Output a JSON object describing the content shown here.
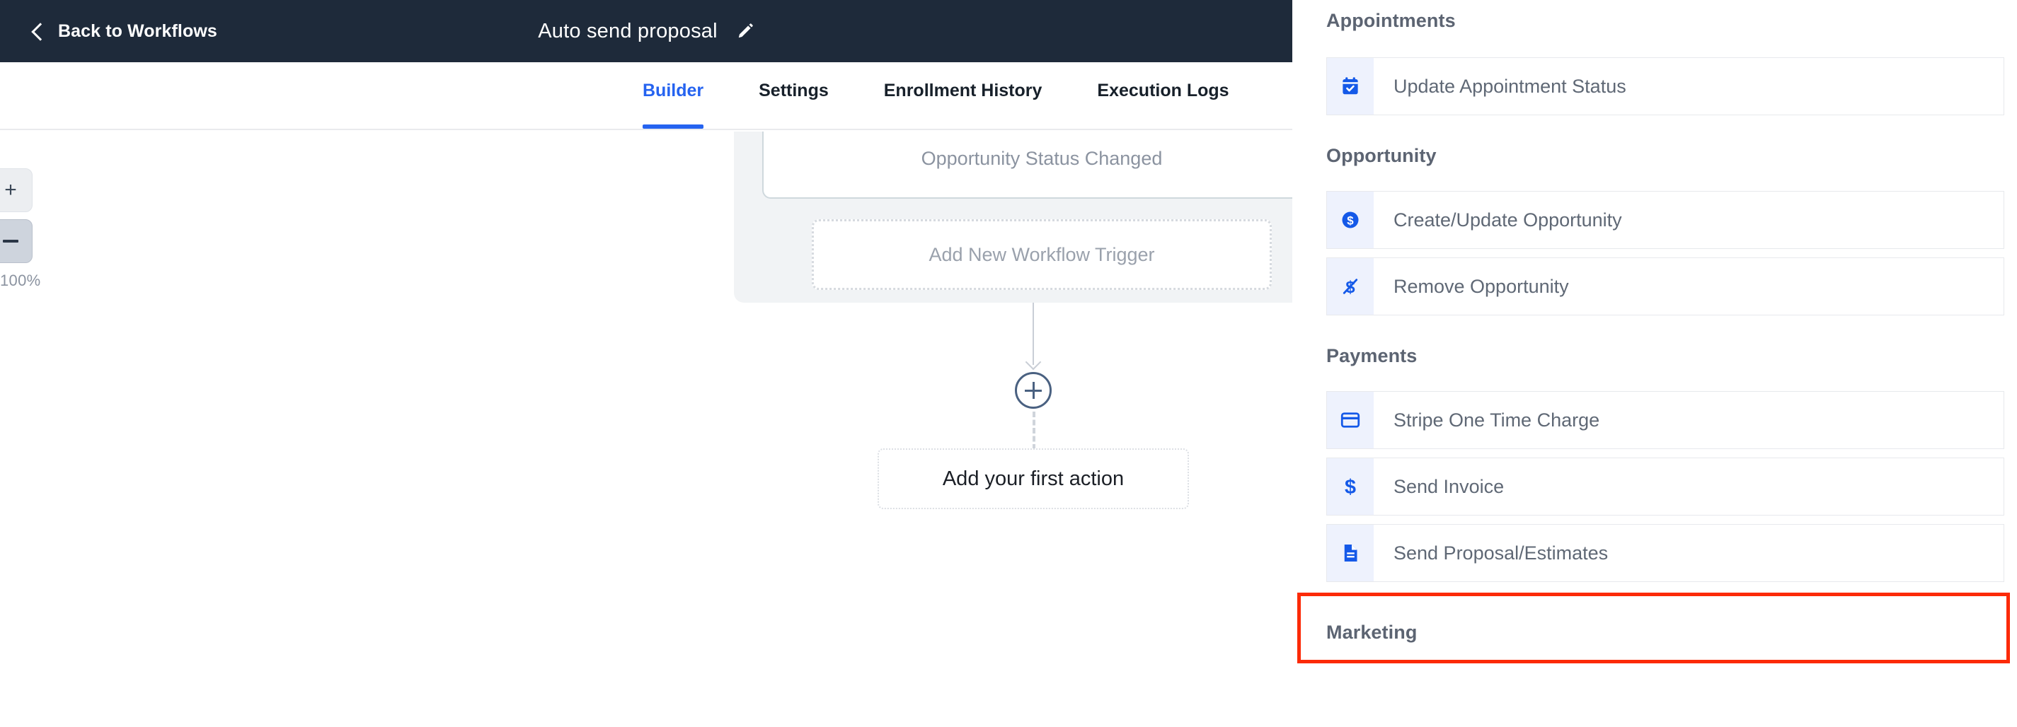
{
  "header": {
    "back_label": "Back to Workflows",
    "back_icon": "chevron-left-icon",
    "title": "Auto send proposal",
    "edit_icon": "pencil-edit-icon",
    "bg_color": "#1e2a3a"
  },
  "tabs": [
    {
      "label": "Builder",
      "active": true
    },
    {
      "label": "Settings",
      "active": false
    },
    {
      "label": "Enrollment History",
      "active": false
    },
    {
      "label": "Execution Logs",
      "active": false
    }
  ],
  "accent_color": "#2563f0",
  "canvas": {
    "zoom": {
      "in_label": "+",
      "out_label": "−",
      "level": "100%"
    },
    "trigger_card_label": "Opportunity Status Changed",
    "add_trigger_label": "Add New Workflow Trigger",
    "plus_node_icon": "plus-circle-icon",
    "first_action_label": "Add your first action"
  },
  "panel": {
    "sections": [
      {
        "title": "Appointments",
        "items": [
          {
            "label": "Update Appointment Status",
            "icon": "calendar-check-icon",
            "highlighted": false
          }
        ]
      },
      {
        "title": "Opportunity",
        "items": [
          {
            "label": "Create/Update Opportunity",
            "icon": "dollar-circle-icon",
            "highlighted": false
          },
          {
            "label": "Remove Opportunity",
            "icon": "dollar-slash-icon",
            "highlighted": false
          }
        ]
      },
      {
        "title": "Payments",
        "items": [
          {
            "label": "Stripe One Time Charge",
            "icon": "credit-card-icon",
            "highlighted": false
          },
          {
            "label": "Send Invoice",
            "icon": "dollar-sign-icon",
            "highlighted": false
          },
          {
            "label": "Send Proposal/Estimates",
            "icon": "document-lines-icon",
            "highlighted": true
          }
        ]
      },
      {
        "title": "Marketing",
        "items": []
      }
    ],
    "icon_color": "#1459e8",
    "icon_bg_color": "#eef2fd",
    "highlight_color": "#fc2a07"
  }
}
